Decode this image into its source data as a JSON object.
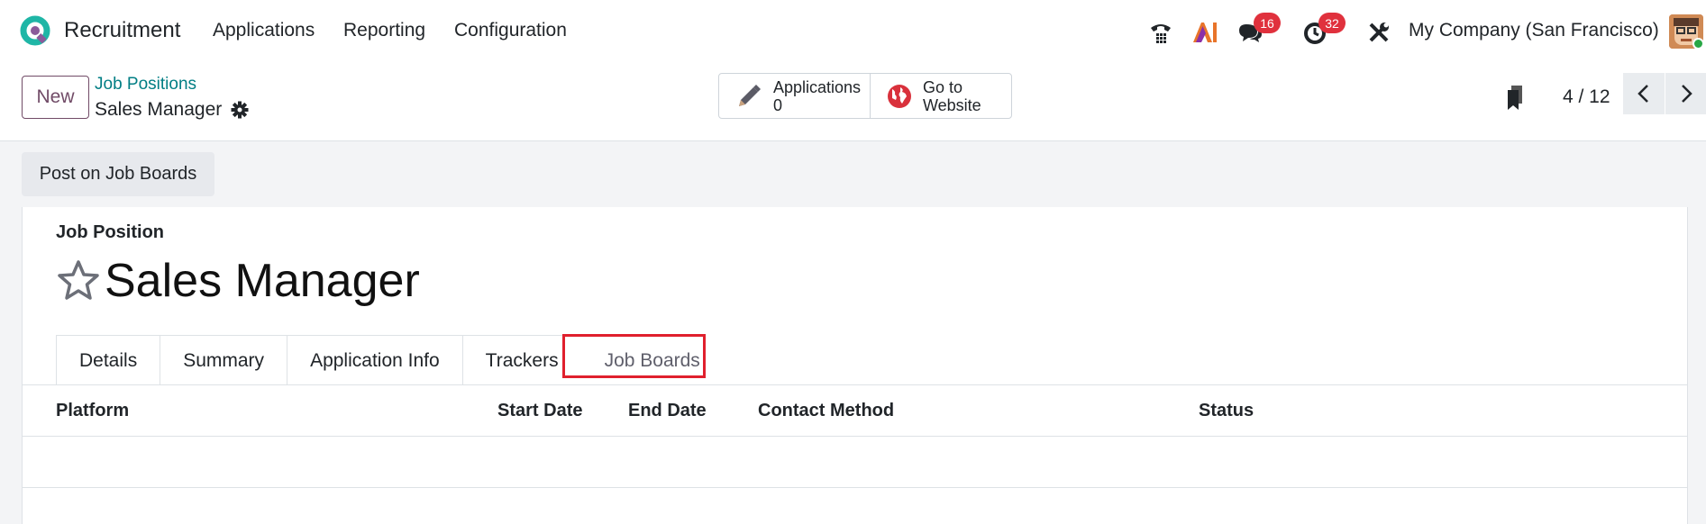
{
  "topbar": {
    "app_name": "Recruitment",
    "menu": [
      "Applications",
      "Reporting",
      "Configuration"
    ],
    "messages_count": "16",
    "activities_count": "32",
    "company": "My Company (San Francisco)"
  },
  "controlbar": {
    "new_label": "New",
    "breadcrumb": "Job Positions",
    "record_name": "Sales Manager",
    "smart_buttons": {
      "applications_label": "Applications",
      "applications_count": "0",
      "website_line1": "Go to",
      "website_line2": "Website"
    },
    "pager": "4 / 12"
  },
  "actions": {
    "post_label": "Post on Job Boards"
  },
  "form": {
    "field_label": "Job Position",
    "title": "Sales Manager",
    "tabs": [
      "Details",
      "Summary",
      "Application Info",
      "Trackers",
      "Job Boards"
    ],
    "table_headers": [
      "Platform",
      "Start Date",
      "End Date",
      "Contact Method",
      "Status"
    ]
  },
  "colors": {
    "brand": "#714b67",
    "link": "#017e84",
    "badge": "#e0313d",
    "highlight": "#e0202d"
  }
}
